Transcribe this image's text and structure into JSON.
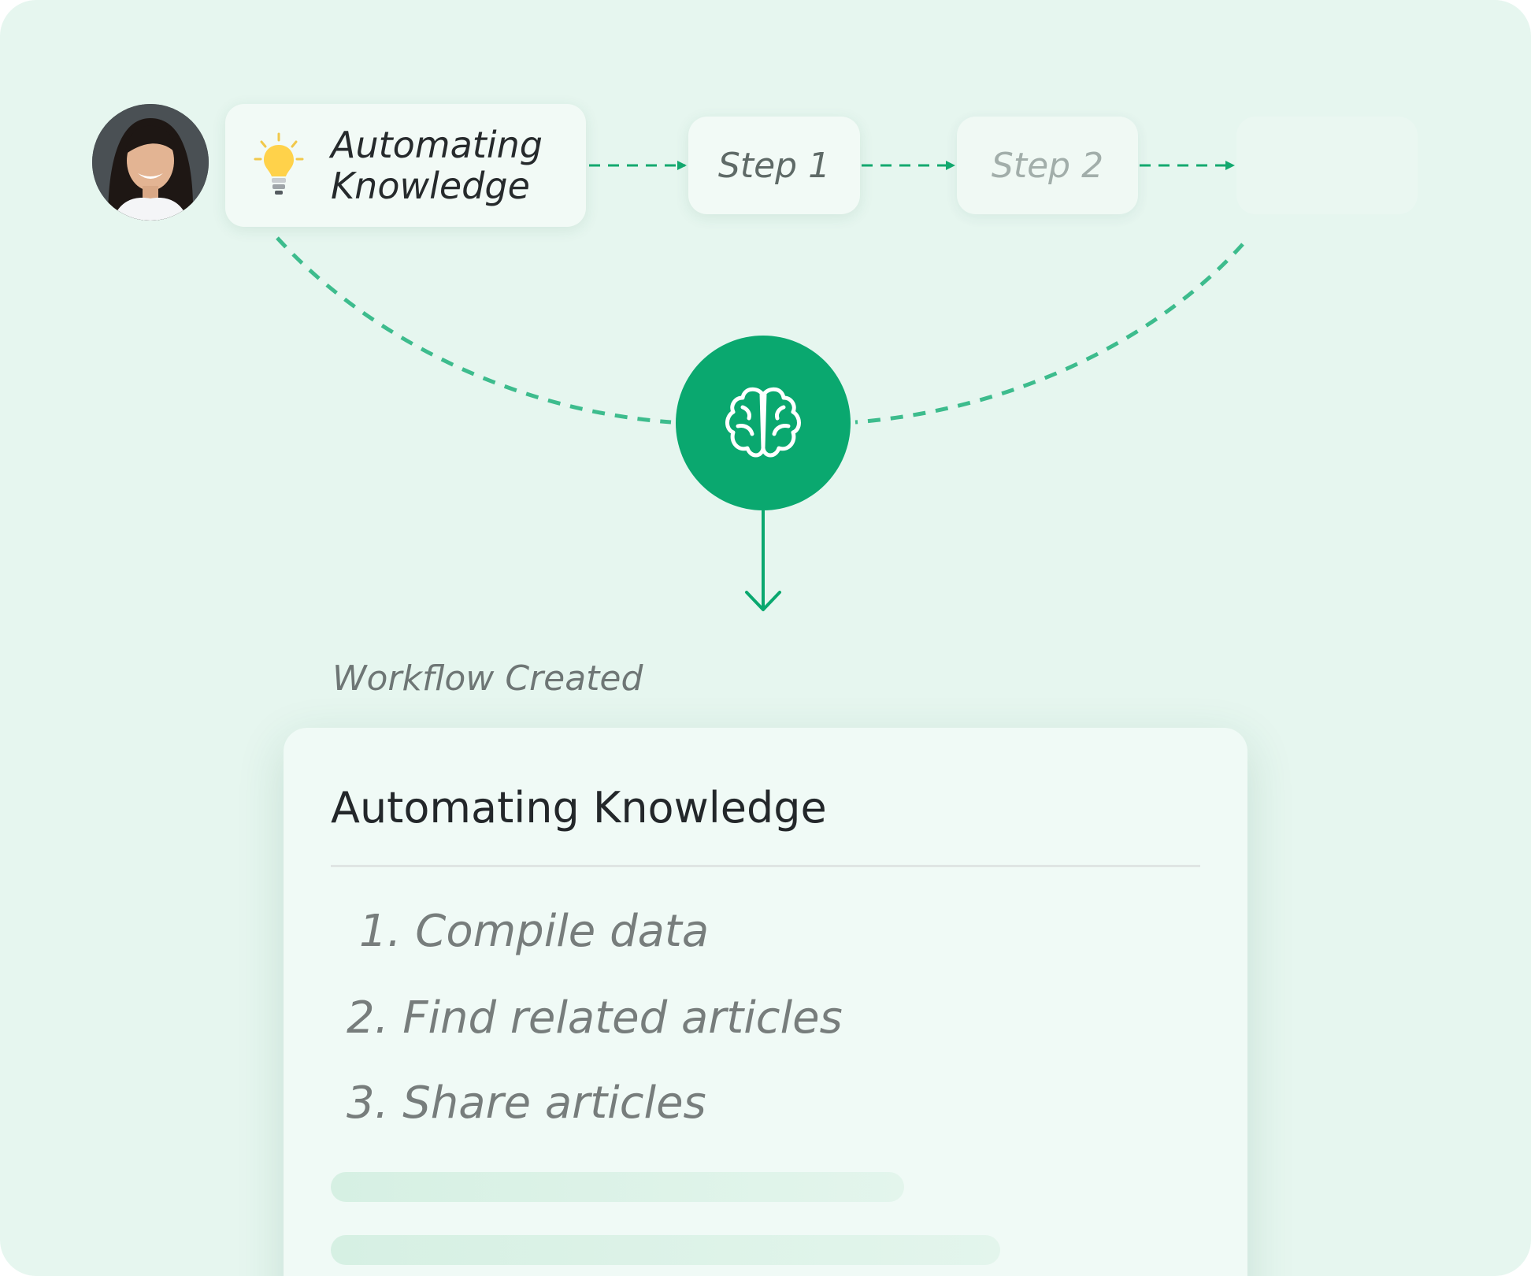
{
  "idea": {
    "title": "Automating Knowledge",
    "icon": "lightbulb-icon"
  },
  "steps": [
    {
      "label": "Step 1"
    },
    {
      "label": "Step 2"
    }
  ],
  "hub": {
    "icon": "brain-icon"
  },
  "workflow": {
    "caption": "Workflow Created",
    "title": "Automating Knowledge",
    "items": [
      "1. Compile data",
      "2. Find related articles",
      "3. Share articles"
    ]
  },
  "colors": {
    "background": "#e6f6ef",
    "accent": "#0aa86f",
    "card": "#f0faf6",
    "text_dark": "#23272a",
    "text_muted": "#777d7c"
  }
}
